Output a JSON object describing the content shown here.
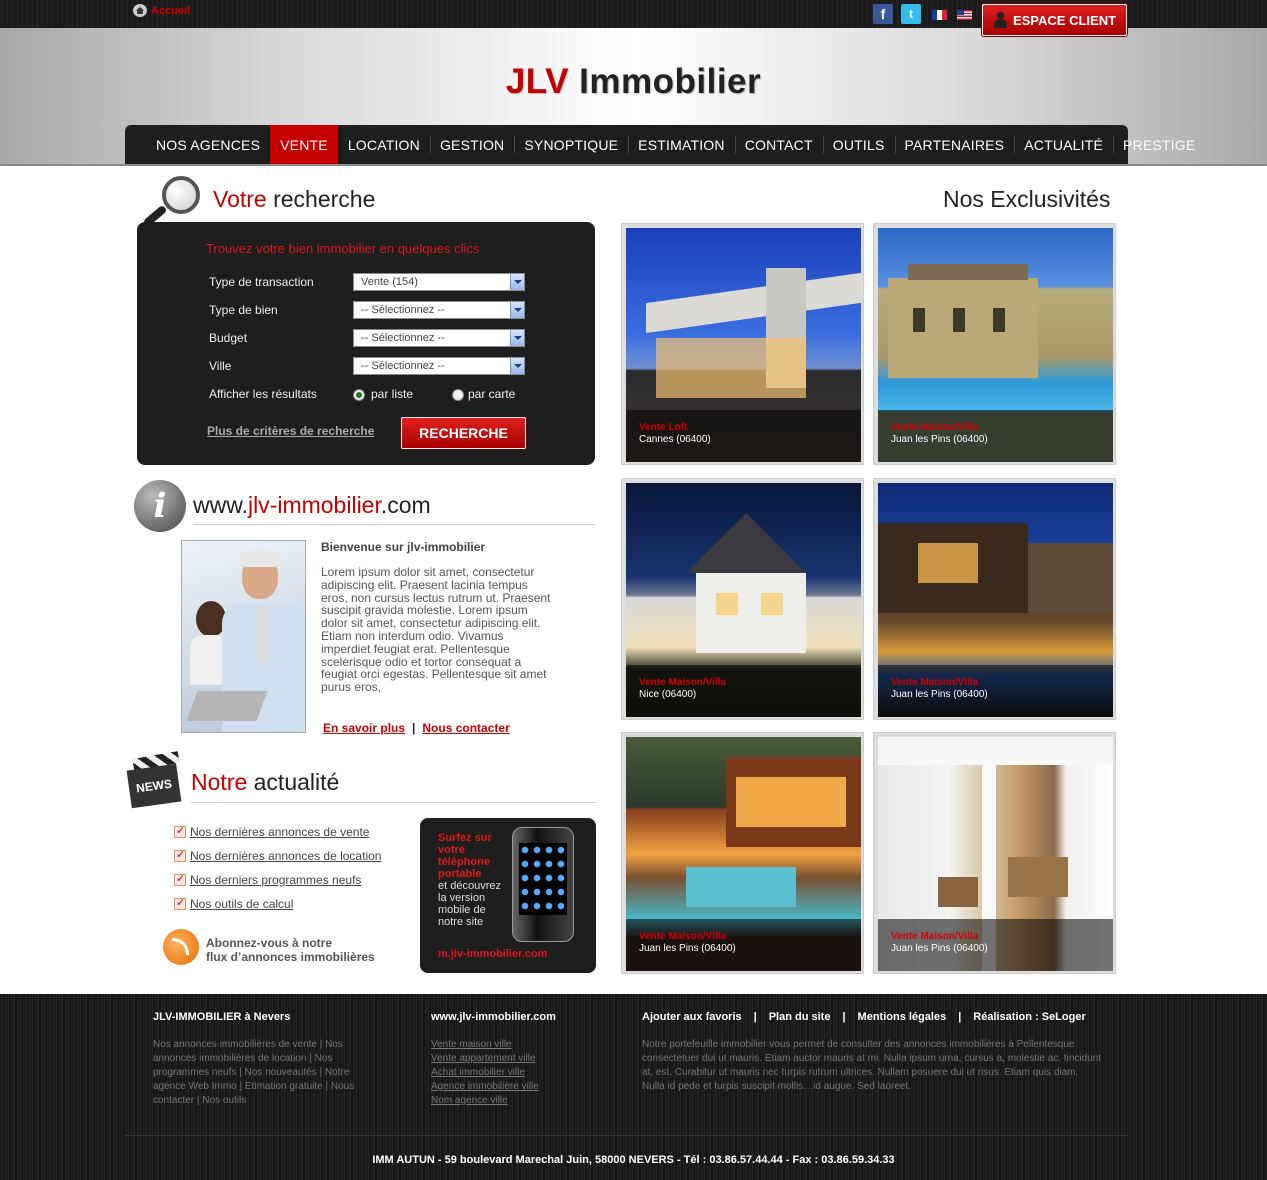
{
  "topbar": {
    "home_label": "Accueil",
    "social": [
      {
        "icon": "facebook-icon",
        "glyph": "f"
      },
      {
        "icon": "twitter-icon",
        "glyph": "t"
      }
    ],
    "flags": [
      "flag-france-icon",
      "flag-usa-icon"
    ],
    "espace_client": "ESPACE CLIENT"
  },
  "header": {
    "logo_red": "JLV",
    "logo_rest": " Immobilier"
  },
  "nav": {
    "active_index": 1,
    "items": [
      "NOS AGENCES",
      "VENTE",
      "LOCATION",
      "GESTION",
      "SYNOPTIQUE",
      "ESTIMATION",
      "CONTACT",
      "OUTILS",
      "PARTENAIRES",
      "ACTUALITÉ",
      "PRESTIGE"
    ]
  },
  "search": {
    "title_red": "Votre",
    "title_rest": " recherche",
    "box_title": "Trouvez votre bien immobilier en quelques clics",
    "rows": [
      {
        "label": "Type de transaction",
        "value": "Vente (154)"
      },
      {
        "label": "Type de bien",
        "value": "-- Sélectionnez --"
      },
      {
        "label": "Budget",
        "value": "-- Sélectionnez --"
      },
      {
        "label": "Ville",
        "value": "-- Sélectionnez --"
      }
    ],
    "display_label": "Afficher les résultats",
    "radio_list": "par liste",
    "radio_map": "par carte",
    "selected_display": "par liste",
    "more_criteria": "Plus de critères de recherche",
    "button": "RECHERCHE"
  },
  "info": {
    "title_pre": "www.",
    "title_red": "jlv-immobilier",
    "title_post": ".com",
    "welcome": "Bienvenue sur jlv-immobilier",
    "lorem": "Lorem ipsum dolor sit amet, consectetur adipiscing elit. Praesent lacinia tempus eros, non cursus lectus rutrum ut. Praesent suscipit gravida molestie. Lorem ipsum dolor sit amet, consectetur adipiscing elit. Etiam non interdum odio. Vivamus imperdiet feugiat erat. Pellentesque scelerisque odio et tortor consequat a feugiat orci egestas. Pellentesque sit amet purus eros,",
    "link_more": "En savoir plus",
    "separator": "|",
    "link_contact": "Nous contacter"
  },
  "news": {
    "title_red": "Notre",
    "title_rest": " actualité",
    "clap_label": "NEWS",
    "items": [
      "Nos dernières annonces de vente",
      "Nos dernières annonces de location",
      "Nos derniers programmes neufs",
      "Nos outils de calcul"
    ],
    "rss_line1": "Abonnez-vous à notre",
    "rss_line2": "flux d’annonces immobilières"
  },
  "mobile": {
    "red_text": "Surfez sur votre téléphone portable",
    "white_text": "et découvrez la version mobile de notre site",
    "url": "m.jlv-immobilier.com"
  },
  "exclusives": {
    "title": "Nos Exclusivités",
    "items": [
      {
        "type": "Vente Loft",
        "city": "Cannes (06400)"
      },
      {
        "type": "Vente Maison/Villa",
        "city": "Juan les Pins (06400)"
      },
      {
        "type": "Vente Maison/Villa",
        "city": "Nice (06400)"
      },
      {
        "type": "Vente Maison/Villa",
        "city": "Juan les Pins (06400)"
      },
      {
        "type": "Vente Maison/Villa",
        "city": "Juan les Pins (06400)"
      },
      {
        "type": "Vente Maison/Villa",
        "city": "Juan les Pins (06400)"
      }
    ]
  },
  "footer": {
    "col1_title": "JLV-IMMOBILIER à Nevers",
    "col1_text": "Nos annonces immobilières de vente | Nos annonces immobilières de location | Nos programmes neufs | Nos nouveautés | Notre agence Web Immo | Etimation gratuite | Nous contacter | Nos outils",
    "col2_title": "www.jlv-immobilier.com",
    "col2_links": [
      "Vente maison ville",
      "Vente appartement ville",
      "Achat immobilier ville",
      "Agence immobilière ville",
      "Nom agence ville"
    ],
    "menu": [
      "Ajouter aux favoris",
      "|",
      "Plan du site",
      "|",
      "Mentions légales",
      "|",
      "Réalisation : SeLoger"
    ],
    "col3_text": "Notre portefeuille immobilier vous permet de consulter des annonces immobilières à Pellentesque consectetuer dui ut mauris. Etiam auctor mauris at mi. Nulla ipsum urna, cursus a, molestie ac, tincidunt at, est. Curabitur ut mauris nec turpis rutrum ultrices. Nullam posuere dui ut risus. Etiam quis diam. Nulla id pede et turpis suscipit mollis…id augue. Sed laoreet.",
    "address": "IMM AUTUN  -  59 boulevard Marechal Juin, 58000 NEVERS  -  Tél : 03.86.57.44.44  -  Fax : 03.86.59.34.33"
  },
  "colors": {
    "accent_red": "#c40000",
    "dark_panel": "#1e1e1e"
  }
}
